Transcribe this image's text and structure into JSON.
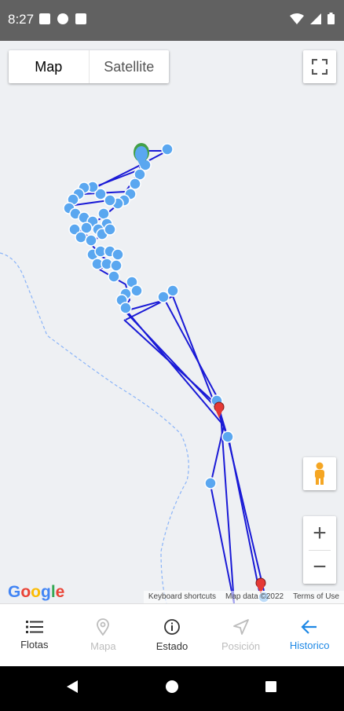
{
  "status_bar": {
    "time": "8:27",
    "left_icons": [
      "photo-icon",
      "alert-icon",
      "sd-card-icon"
    ],
    "right_icons": [
      "wifi-icon",
      "cell-signal-icon",
      "battery-icon"
    ]
  },
  "map": {
    "map_type": {
      "map_label": "Map",
      "satellite_label": "Satellite",
      "selected": "Map"
    },
    "controls": {
      "fullscreen_icon": "fullscreen-icon",
      "pegman_icon": "pegman-icon",
      "zoom_in_label": "+",
      "zoom_out_label": "−"
    },
    "google_logo": "Google",
    "attribution": {
      "keyboard": "Keyboard shortcuts",
      "map_data": "Map data ©2022",
      "terms": "Terms of Use"
    },
    "colors": {
      "route": "#1a1ad6",
      "marker": "#5aa7f0",
      "end_marker": "#e53935",
      "start_marker": "#43a047",
      "water": "#8ab4f8"
    }
  },
  "bottom_nav": {
    "items": [
      {
        "label": "Flotas",
        "icon": "list-icon",
        "state": "normal"
      },
      {
        "label": "Mapa",
        "icon": "map-pin-icon",
        "state": "muted"
      },
      {
        "label": "Estado",
        "icon": "info-icon",
        "state": "normal"
      },
      {
        "label": "Posición",
        "icon": "navigation-icon",
        "state": "muted"
      },
      {
        "label": "Historico",
        "icon": "arrow-back-icon",
        "state": "active"
      }
    ]
  },
  "system_nav": {
    "icons": [
      "back-icon",
      "home-icon",
      "recents-icon"
    ]
  }
}
